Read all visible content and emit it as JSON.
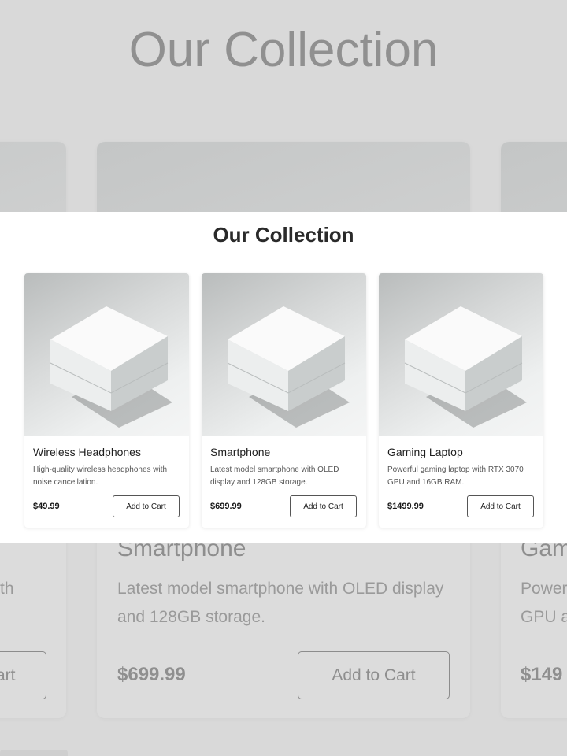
{
  "page": {
    "title": "Our Collection"
  },
  "products": [
    {
      "name": "Wireless Headphones",
      "description": "High-quality wireless headphones with noise cancellation.",
      "price": "$49.99",
      "button_label": "Add to Cart",
      "image_icon": "product-box-icon"
    },
    {
      "name": "Smartphone",
      "description": "Latest model smartphone with OLED display and 128GB storage.",
      "price": "$699.99",
      "button_label": "Add to Cart",
      "image_icon": "product-box-icon"
    },
    {
      "name": "Gaming Laptop",
      "description": "Powerful gaming laptop with RTX 3070 GPU and 16GB RAM.",
      "price": "$1499.99",
      "button_label": "Add to Cart",
      "image_icon": "product-box-icon"
    }
  ],
  "background": {
    "left_desc_fragment": "th",
    "left_button_fragment": "art",
    "right_name_fragment": "Gam",
    "right_desc_fragment_1": "Power",
    "right_desc_fragment_2": "GPU a",
    "right_price_fragment": "$149"
  },
  "colors": {
    "backdrop": "#d9d9d9",
    "panel": "#ffffff",
    "text_dark": "#2a2a2a"
  }
}
